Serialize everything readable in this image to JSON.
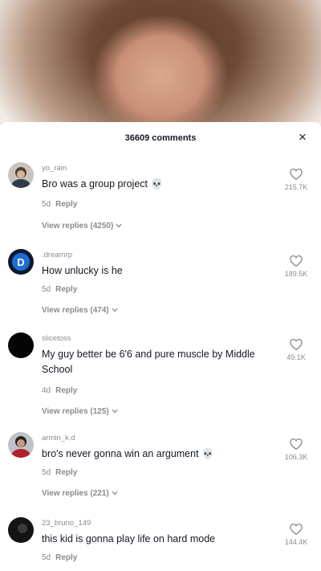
{
  "header": {
    "comment_count": "36609 comments",
    "close_glyph": "×"
  },
  "icons": {
    "close": "close-icon",
    "like": "heart-icon",
    "chevron": "chevron-down-icon"
  },
  "colors": {
    "text": "#161823",
    "muted": "#8a8b91",
    "background": "#ffffff"
  },
  "comments": [
    {
      "username": "yo_rain",
      "text": "Bro was a group project 💀",
      "age": "5d",
      "reply_label": "Reply",
      "view_replies": "View replies (4250)",
      "likes": "215.7K"
    },
    {
      "username": ".dreamrp",
      "text": "How unlucky is he",
      "age": "5d",
      "reply_label": "Reply",
      "view_replies": "View replies (474)",
      "likes": "189.5K"
    },
    {
      "username": "slicetoss",
      "text": "My guy better be 6'6 and pure muscle by Middle School",
      "age": "4d",
      "reply_label": "Reply",
      "view_replies": "View replies (125)",
      "likes": "49.1K"
    },
    {
      "username": "armin_k.d",
      "text": "bro's never gonna win an argument 💀",
      "age": "5d",
      "reply_label": "Reply",
      "view_replies": "View replies (221)",
      "likes": "106.3K"
    },
    {
      "username": "23_bruno_149",
      "text": "this kid is gonna play life on hard mode",
      "age": "5d",
      "reply_label": "Reply",
      "likes": "144.4K"
    }
  ]
}
